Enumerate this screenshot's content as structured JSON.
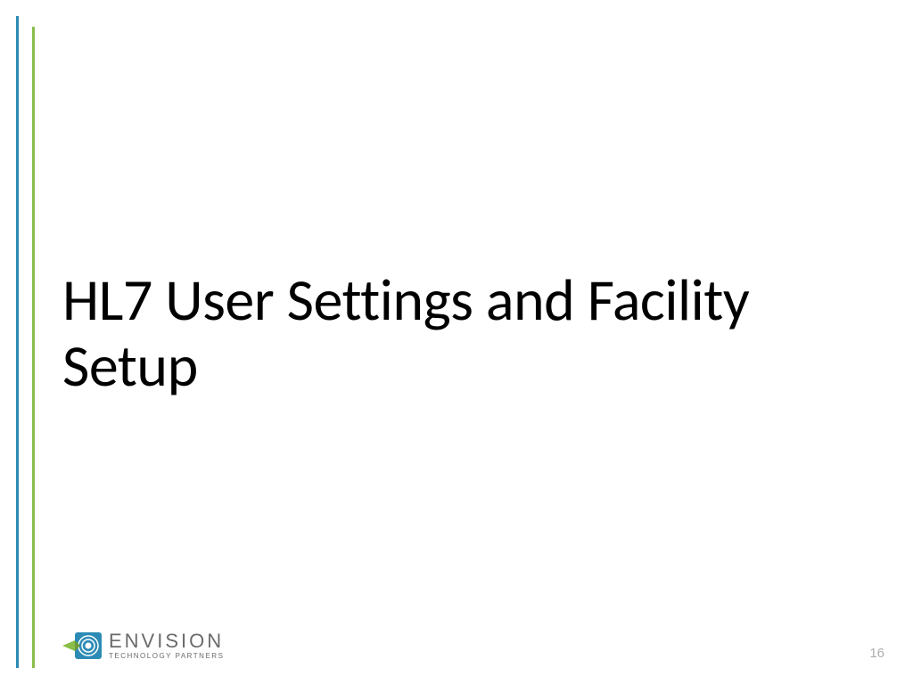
{
  "slide": {
    "title": "HL7 User Settings and Facility Setup",
    "page_number": "16"
  },
  "logo": {
    "main": "ENVISION",
    "sub": "TECHNOLOGY PARTNERS"
  },
  "decor": {
    "blue_bar_color": "#2b8bb5",
    "green_bar_color": "#8bbd4a"
  }
}
